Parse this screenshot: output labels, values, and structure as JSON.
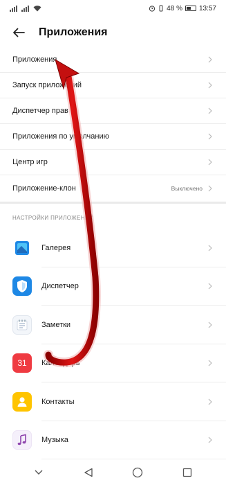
{
  "status": {
    "battery_percent": "48 %",
    "time": "13:57"
  },
  "header": {
    "title": "Приложения",
    "back_icon": "arrow-left-icon"
  },
  "settings": [
    {
      "label": "Приложения",
      "value": ""
    },
    {
      "label": "Запуск приложений",
      "value": ""
    },
    {
      "label": "Диспетчер прав",
      "value": ""
    },
    {
      "label": "Приложения по умолчанию",
      "value": ""
    },
    {
      "label": "Центр игр",
      "value": ""
    },
    {
      "label": "Приложение-клон",
      "value": "Выключено"
    }
  ],
  "section": {
    "title": "НАСТРОЙКИ ПРИЛОЖЕНИЙ"
  },
  "apps": [
    {
      "label": "Галерея",
      "icon": "gallery-icon"
    },
    {
      "label": "Диспетчер",
      "icon": "shield-icon"
    },
    {
      "label": "Заметки",
      "icon": "notes-icon"
    },
    {
      "label": "Календарь",
      "icon": "calendar-icon",
      "icon_text": "31"
    },
    {
      "label": "Контакты",
      "icon": "contact-icon"
    },
    {
      "label": "Музыка",
      "icon": "music-icon"
    }
  ],
  "colors": {
    "arrow": "#d01010",
    "divider": "#eaeaea",
    "secondary_text": "#888888"
  }
}
